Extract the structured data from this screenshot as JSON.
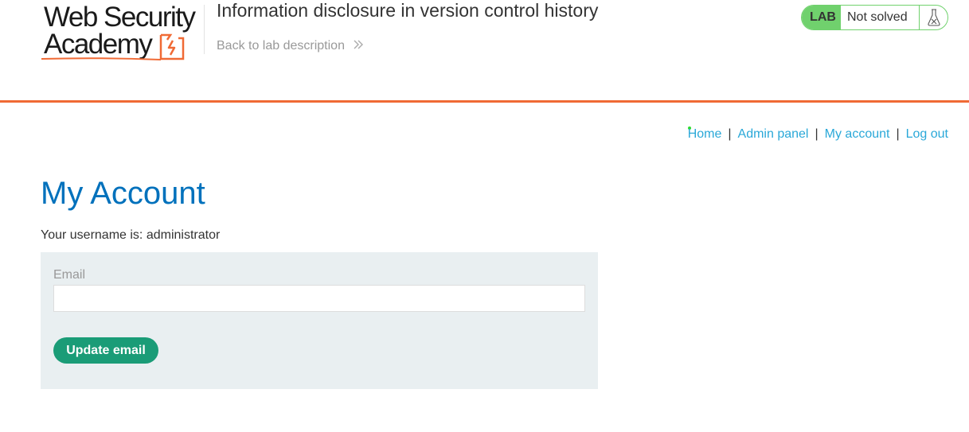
{
  "header": {
    "logo": {
      "line1": "Web Security",
      "line2": "Academy"
    },
    "lab_title": "Information disclosure in version control history",
    "back_link": "Back to lab description",
    "status": {
      "label": "LAB",
      "text": "Not solved"
    }
  },
  "nav": {
    "links": [
      "Home",
      "Admin panel",
      "My account",
      "Log out"
    ],
    "separator": "|"
  },
  "main": {
    "heading": "My Account",
    "username_text": "Your username is: administrator",
    "form": {
      "email_label": "Email",
      "email_value": "",
      "button_label": "Update email"
    }
  },
  "icons": {
    "logo_mark": "lightning-bolt-icon",
    "back_chevron": "double-chevron-right-icon",
    "status_icon": "flask-icon"
  },
  "colors": {
    "accent_orange": "#f06a35",
    "heading_blue": "#0071bc",
    "link_blue": "#2aa8d8",
    "status_green": "#70d16d",
    "button_teal": "#1a9c77",
    "form_bg": "#e9eff1"
  }
}
